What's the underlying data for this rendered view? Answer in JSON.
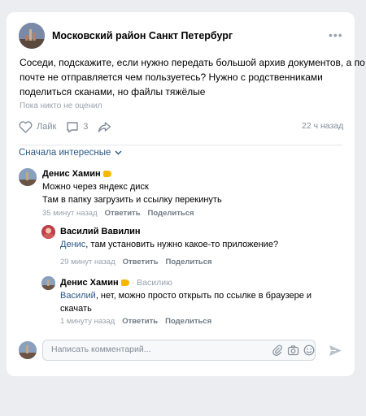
{
  "post": {
    "group_name": "Московский район Санкт Петербург",
    "text_lines": [
      "Соседи, подскажите, если нужно передать большой архив документов, а по",
      "почте не отправляется чем пользуетесь? Нужно с родственниками",
      "поделиться сканами, но файлы тяжёлые"
    ],
    "likers": "Пока никто не оценил",
    "like_label": "Лайк",
    "comments_count": "3",
    "time": "22 ч назад",
    "more_icon": "more-icon"
  },
  "sort_label": "Сначала интересные",
  "comments": [
    {
      "author": "Денис Хамин",
      "text_lines": [
        "Можно через яндекс диск",
        "Там в папку загрузить и ссылку перекинуть"
      ],
      "time": "35 минут назад",
      "reply_label": "Ответить",
      "share_label": "Поделиться"
    },
    {
      "author": "Василий Вавилин",
      "mention": "Денис",
      "text_rest": ", там установить нужно какое-то приложение?",
      "time": "29 минут назад",
      "reply_label": "Ответить",
      "share_label": "Поделиться"
    },
    {
      "author": "Денис Хамин",
      "reply_to": "· Василию",
      "mention": "Василий",
      "text_rest": ", нет, можно просто открыть по ссылке в браузере и",
      "text_line2": "скачать",
      "time": "1 минуту назад",
      "reply_label": "Ответить",
      "share_label": "Поделиться"
    }
  ],
  "composer": {
    "placeholder": "Написать комментарий..."
  },
  "colors": {
    "accent": "#2a5885",
    "muted": "#99a2ad",
    "icon": "#818c99"
  }
}
